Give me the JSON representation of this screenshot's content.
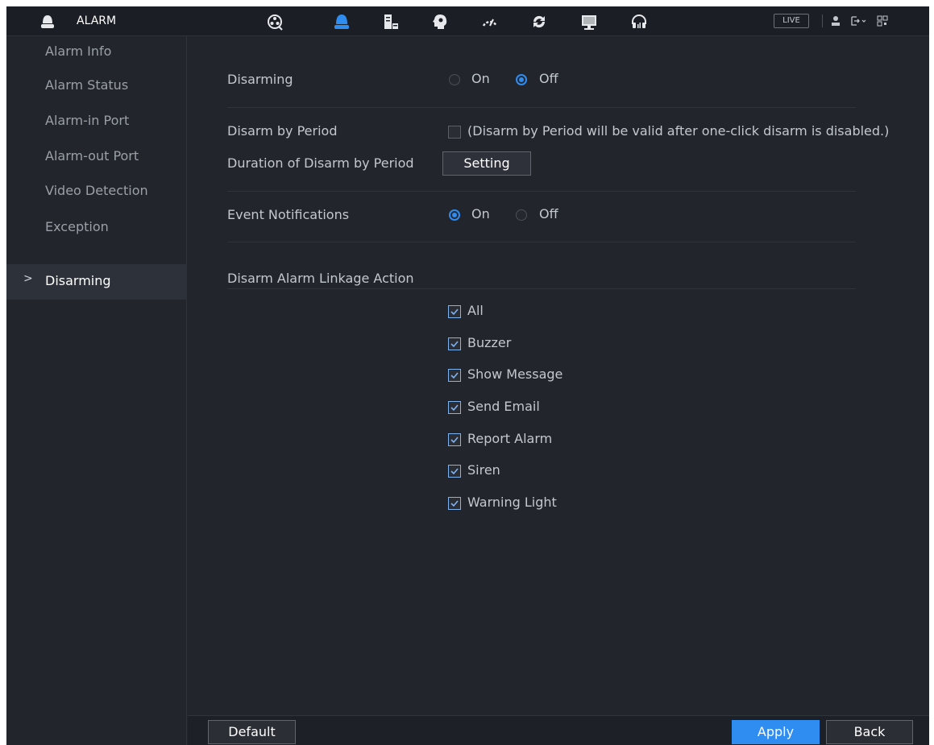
{
  "header": {
    "module_title": "ALARM",
    "live_label": "LIVE",
    "nav_icons": [
      "search-icon",
      "alarm-icon",
      "storage-icon",
      "system-icon",
      "operation-icon",
      "backup-icon",
      "display-icon",
      "audio-icon"
    ],
    "active_icon": "alarm-icon",
    "accent_color": "#2f8cf0"
  },
  "sidebar": {
    "items": [
      {
        "label": "Alarm Info"
      },
      {
        "label": "Alarm Status"
      },
      {
        "label": "Alarm-in Port"
      },
      {
        "label": "Alarm-out Port"
      },
      {
        "label": "Video Detection"
      },
      {
        "label": "Exception"
      },
      {
        "label": "Disarming",
        "active": true
      }
    ],
    "active_chevron": ">"
  },
  "main": {
    "disarming": {
      "label": "Disarming",
      "on_label": "On",
      "off_label": "Off",
      "selected": "Off"
    },
    "disarm_by_period": {
      "label": "Disarm by Period",
      "checked": false,
      "note": "(Disarm by Period will be valid after one-click disarm is disabled.)"
    },
    "duration": {
      "label": "Duration of Disarm by Period",
      "button_label": "Setting"
    },
    "event_notifications": {
      "label": "Event Notifications",
      "on_label": "On",
      "off_label": "Off",
      "selected": "On"
    },
    "linkage": {
      "label": "Disarm Alarm Linkage Action",
      "options": [
        {
          "label": "All",
          "checked": true
        },
        {
          "label": "Buzzer",
          "checked": true
        },
        {
          "label": "Show Message",
          "checked": true
        },
        {
          "label": "Send Email",
          "checked": true
        },
        {
          "label": "Report Alarm",
          "checked": true
        },
        {
          "label": "Siren",
          "checked": true
        },
        {
          "label": "Warning Light",
          "checked": true
        }
      ]
    }
  },
  "footer": {
    "default_label": "Default",
    "apply_label": "Apply",
    "back_label": "Back"
  }
}
